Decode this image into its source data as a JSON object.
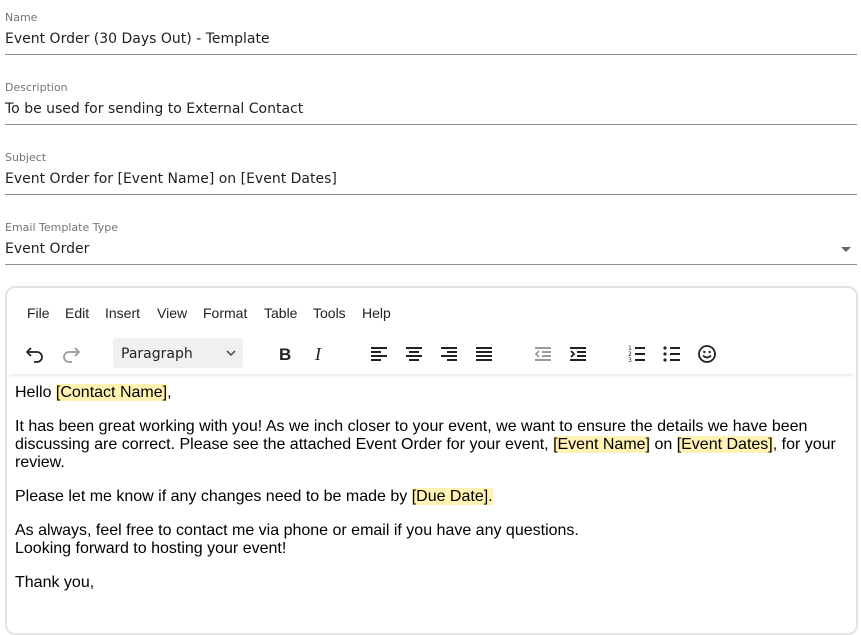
{
  "fields": {
    "name": {
      "label": "Name",
      "value": "Event Order (30 Days Out) - Template"
    },
    "description": {
      "label": "Description",
      "value": "To be used for sending to External Contact"
    },
    "subject": {
      "label": "Subject",
      "value": "Event Order for [Event Name] on [Event Dates]"
    },
    "template_type": {
      "label": "Email Template Type",
      "value": "Event Order"
    }
  },
  "editor": {
    "menu": [
      "File",
      "Edit",
      "Insert",
      "View",
      "Format",
      "Table",
      "Tools",
      "Help"
    ],
    "block_format": "Paragraph",
    "toolbar_icons": [
      "undo-icon",
      "redo-icon",
      "bold-icon",
      "italic-icon",
      "align-left-icon",
      "align-center-icon",
      "align-right-icon",
      "align-justify-icon",
      "outdent-icon",
      "indent-icon",
      "numbered-list-icon",
      "bullet-list-icon",
      "emoji-icon"
    ],
    "body": {
      "p1": {
        "a": "Hello ",
        "t1": "[Contact Name]",
        "b": ","
      },
      "p2": {
        "a": "It has been great working with you!  As we inch closer to your event, we want to ensure the details we have been discussing are correct. Please see the attached Event Order for your event, ",
        "t1": "[Event Name]",
        "b": " on ",
        "t2": "[Event Dates]",
        "c": ", for your review."
      },
      "p3": {
        "a": "Please let me know if any changes need to be made by ",
        "t1": "[Due Date]",
        "b": "."
      },
      "p4": {
        "line1": "As always, feel free to contact me via phone or email if you have any questions.",
        "line2": "Looking forward to hosting your event!"
      },
      "p5": {
        "a": "Thank you,"
      }
    },
    "highlight_color": "#fff2b3"
  }
}
